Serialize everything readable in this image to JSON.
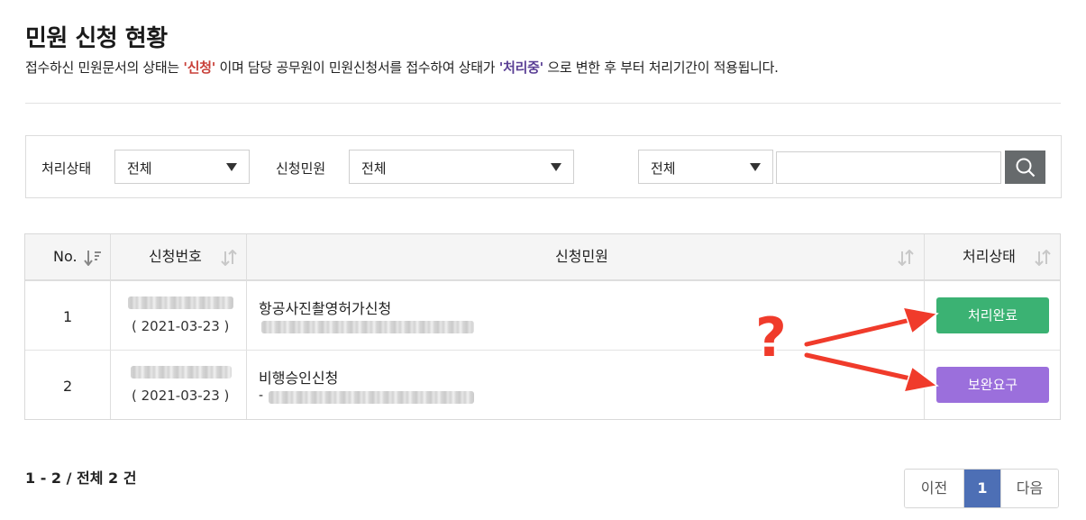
{
  "header": {
    "title": "민원 신청 현황",
    "desc_part1": "접수하신 민원문서의 상태는 ",
    "desc_hl1": "'신청'",
    "desc_part2": " 이며 담당 공무원이 민원신청서를 접수하여 상태가 ",
    "desc_hl2": "'처리중'",
    "desc_part3": " 으로 변한 후 부터 처리기간이 적용됩니다."
  },
  "filters": {
    "status_label": "처리상태",
    "status_value": "전체",
    "petition_label": "신청민원",
    "petition_value": "전체",
    "search_type_value": "전체",
    "search_input_value": ""
  },
  "table": {
    "columns": [
      "No.",
      "신청번호",
      "신청민원",
      "처리상태"
    ],
    "rows": [
      {
        "no": "1",
        "date": "( 2021-03-23 )",
        "title": "항공사진촬영허가신청",
        "sub_prefix": "",
        "status": "처리완료"
      },
      {
        "no": "2",
        "date": "( 2021-03-23 )",
        "title": "비행승인신청",
        "sub_prefix": "-",
        "status": "보완요구"
      }
    ]
  },
  "annotation": {
    "mark": "?"
  },
  "summary": "1 - 2 / 전체 2 건",
  "pagination": {
    "prev": "이전",
    "current": "1",
    "next": "다음"
  },
  "colors": {
    "complete": "#3bb273",
    "supplement": "#9b6fdc",
    "highlight_red": "#c9413a",
    "highlight_purple": "#5a3f95",
    "pager_active": "#4d6fb5",
    "annotation": "#f03b2b"
  }
}
